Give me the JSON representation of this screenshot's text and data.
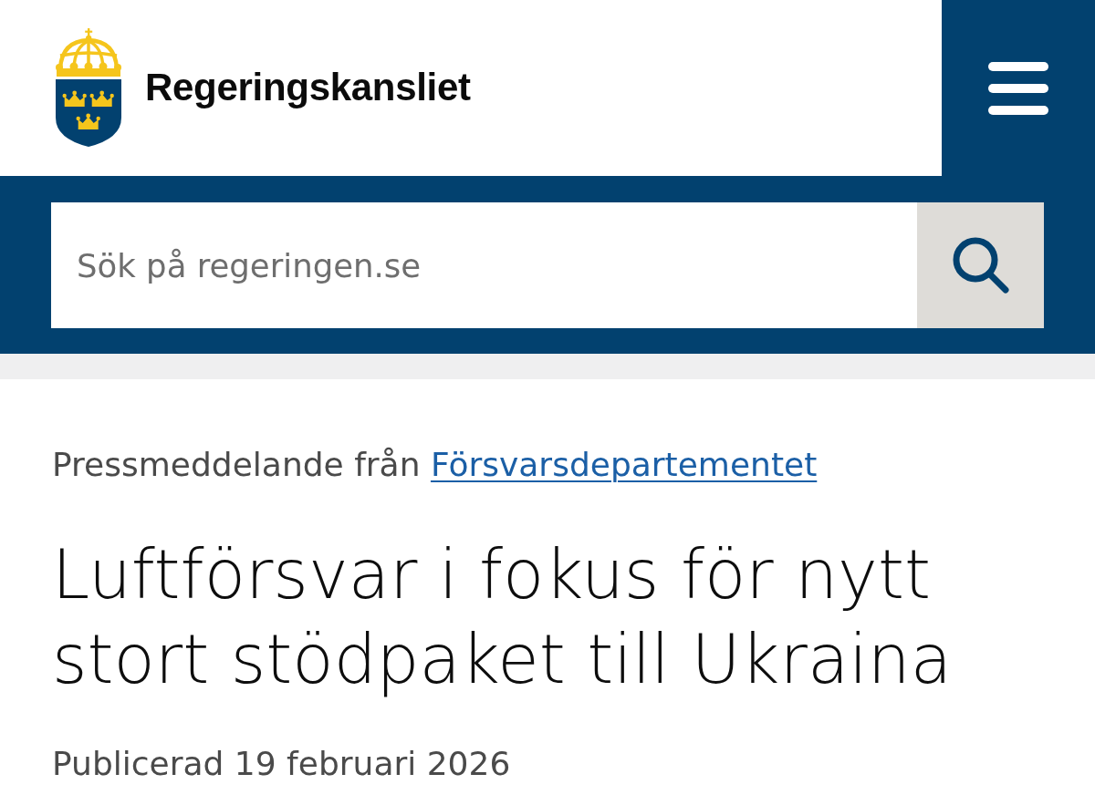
{
  "header": {
    "site_name": "Regeringskansliet"
  },
  "search": {
    "placeholder": "Sök på regeringen.se"
  },
  "article": {
    "kicker": {
      "text": "Pressmeddelande från",
      "link": "Försvarsdepartementet"
    },
    "title": "Luftförsvar i fokus för nytt stort stödpaket till Ukraina",
    "published": "Publicerad 19 februari 2026"
  }
}
